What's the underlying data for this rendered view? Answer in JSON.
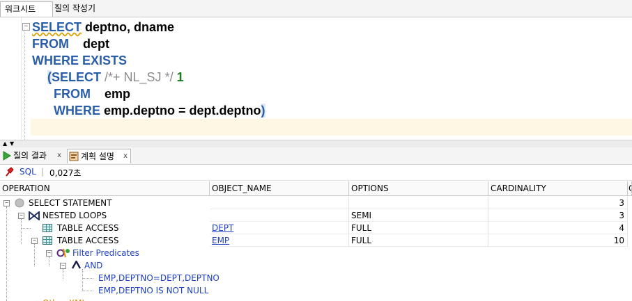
{
  "top_tabs": {
    "worksheet": "워크시트",
    "query_builder": "질의 작성기"
  },
  "editor": {
    "line1": {
      "kw": "SELECT",
      "rest": " deptno, dname"
    },
    "line2": {
      "kw": "FROM",
      "rest": "    dept"
    },
    "line3": {
      "kw": "WHERE EXISTS"
    },
    "line4": {
      "open": "(",
      "kw": "SELECT",
      "comment": " /*+ NL_SJ */",
      "num": " 1"
    },
    "line5": {
      "kw": "FROM",
      "rest": "    emp"
    },
    "line6": {
      "kw": "WHERE",
      "rest": " emp.deptno = dept.deptno",
      "close": ")"
    }
  },
  "result_tabs": {
    "query_result": "질의 결과",
    "explain_plan": "계획 설명",
    "close": "x"
  },
  "toolbar": {
    "sql_label": "SQL",
    "separator": "|",
    "elapsed": "0,027초"
  },
  "grid": {
    "columns": [
      "OPERATION",
      "OBJECT_NAME",
      "OPTIONS",
      "CARDINALITY",
      "C"
    ],
    "rows": [
      {
        "operation": "SELECT STATEMENT",
        "object_name": "",
        "options": "",
        "cardinality": "3"
      },
      {
        "operation": "NESTED LOOPS",
        "object_name": "",
        "options": "SEMI",
        "cardinality": "3"
      },
      {
        "operation": "TABLE ACCESS",
        "object_name": "DEPT",
        "options": "FULL",
        "cardinality": "4"
      },
      {
        "operation": "TABLE ACCESS",
        "object_name": "EMP",
        "options": "FULL",
        "cardinality": "10"
      }
    ],
    "filter_predicates": "Filter Predicates",
    "and_label": "AND",
    "predicate1": "EMP,DEPTNO=DEPT,DEPTNO",
    "predicate2": "EMP,DEPTNO IS NOT NULL",
    "partial_row": "Other XML"
  },
  "colors": {
    "keyword": "#2b5ea8",
    "link": "#1d3fc0",
    "current_line": "#fdf7e4"
  }
}
